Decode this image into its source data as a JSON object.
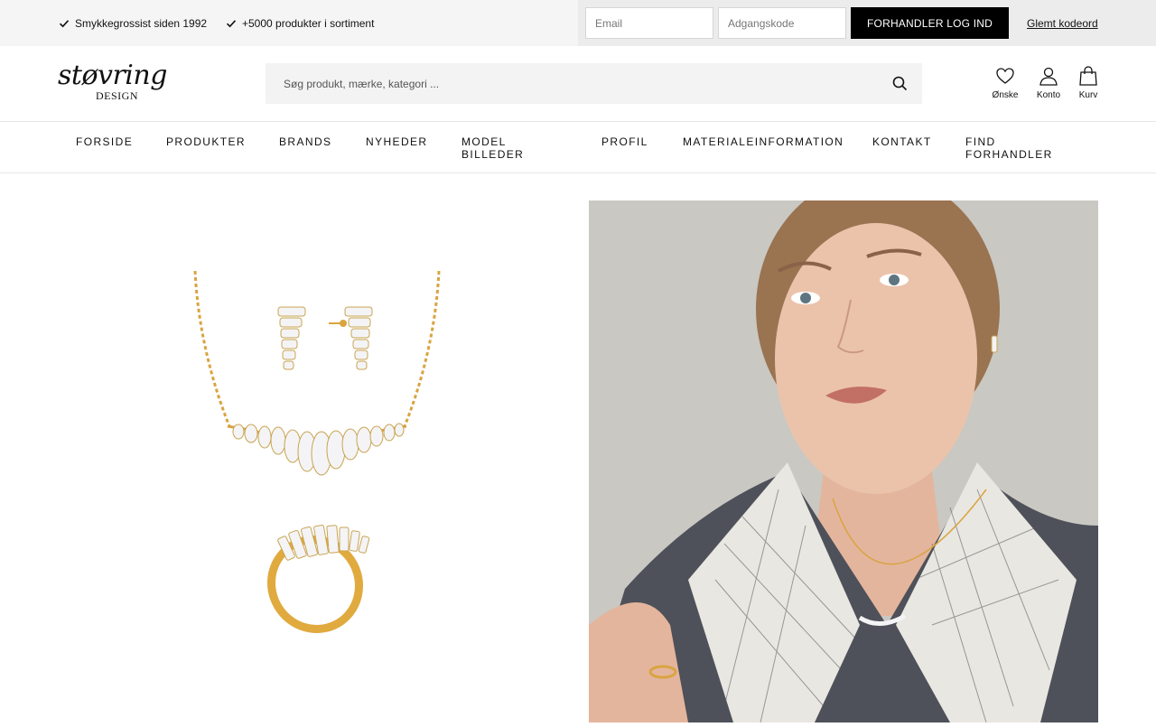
{
  "topbar": {
    "usps": [
      "Smykkegrossist siden 1992",
      "+5000 produkter i sortiment"
    ],
    "email_placeholder": "Email",
    "password_placeholder": "Adgangskode",
    "login_button": "FORHANDLER LOG IND",
    "forgot_link": "Glemt kodeord"
  },
  "header": {
    "logo_main": "støvring",
    "logo_sub": "DESIGN",
    "search_placeholder": "Søg produkt, mærke, kategori ...",
    "icons": {
      "wishlist_label": "Ønske",
      "account_label": "Konto",
      "cart_label": "Kurv"
    }
  },
  "nav": {
    "items": [
      "FORSIDE",
      "PRODUKTER",
      "BRANDS",
      "NYHEDER",
      "MODEL BILLEDER",
      "PROFIL",
      "MATERIALEINFORMATION",
      "KONTAKT",
      "FIND FORHANDLER"
    ]
  },
  "colors": {
    "topbar_bg": "#f5f5f5",
    "login_bg": "#ececec",
    "button_bg": "#000000",
    "gold": "#d9a441",
    "model_bg": "#c9c8c3"
  },
  "images": {
    "product": "jewelry-set-image",
    "model": "model-photo"
  }
}
